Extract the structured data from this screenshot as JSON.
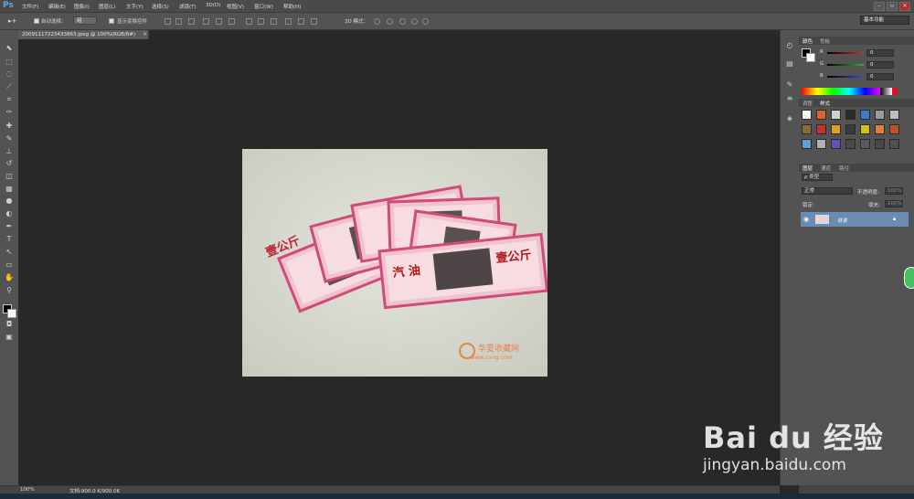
{
  "app": {
    "logo": "Ps"
  },
  "menu": [
    "文件(F)",
    "编辑(E)",
    "图像(I)",
    "图层(L)",
    "文字(Y)",
    "选择(S)",
    "滤镜(T)",
    "3D(D)",
    "视图(V)",
    "窗口(W)",
    "帮助(H)"
  ],
  "window_controls": [
    "–",
    "▫",
    "✕"
  ],
  "options": {
    "auto_select_label": "自动选择：",
    "auto_select_value": "组",
    "show_transform_label": "显示变换控件",
    "mode3d_label": "3D 模式：",
    "workspace": "基本功能"
  },
  "document": {
    "tab_title": "20091117223433863.jpeg @ 100%(RGB/8#)",
    "tab_close": "×",
    "photo": {
      "ticket_left": "壹公斤",
      "ticket_main_left": "汽 油",
      "ticket_main_right": "壹公斤",
      "watermark_cn": "华夏收藏网",
      "watermark_en": "www.cang.com"
    }
  },
  "panels": {
    "color": {
      "tabs": [
        "颜色",
        "色板"
      ],
      "channels": [
        {
          "label": "R",
          "value": "0",
          "color": "#d23030"
        },
        {
          "label": "G",
          "value": "0",
          "color": "#30b030"
        },
        {
          "label": "B",
          "value": "0",
          "color": "#3050d0"
        }
      ]
    },
    "adjust": {
      "tabs": [
        "调整",
        "样式"
      ]
    },
    "layers": {
      "tabs": [
        "图层",
        "通道",
        "路径"
      ],
      "kind_label": "ρ 类型",
      "blend_mode": "正常",
      "opacity_label": "不透明度:",
      "opacity_value": "100%",
      "lock_label": "锁定:",
      "fill_label": "填充:",
      "fill_value": "100%",
      "layer_name": "背景"
    }
  },
  "status": {
    "zoom": "100%",
    "doc_info": "文档:900.0 K/900.0K"
  },
  "watermark": {
    "brand": "Bai du 经验",
    "url": "jingyan.baidu.com"
  },
  "icons": [
    "move-tool-icon",
    "marquee-tool-icon",
    "lasso-tool-icon",
    "quick-select-tool-icon",
    "crop-tool-icon",
    "eyedropper-tool-icon",
    "healing-brush-icon",
    "brush-tool-icon",
    "clone-stamp-icon",
    "history-brush-icon",
    "eraser-icon",
    "gradient-icon",
    "blur-icon",
    "dodge-icon",
    "pen-tool-icon",
    "type-tool-icon",
    "path-select-icon",
    "rectangle-tool-icon",
    "hand-tool-icon",
    "zoom-tool-icon"
  ]
}
